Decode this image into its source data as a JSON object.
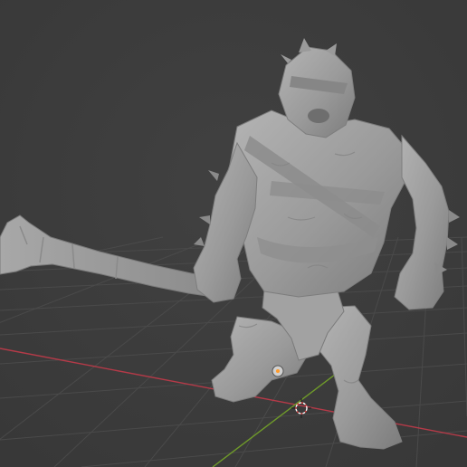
{
  "viewport": {
    "background": "#3d3d3d",
    "grid_color": "#4a4a4a",
    "x_axis_color": "#b43a48",
    "y_axis_color": "#6f9a2a",
    "model_color": "#9e9e9e",
    "model_name": "ogre-sculpt-with-club",
    "gizmos": [
      "3d-cursor-icon",
      "object-origin-icon"
    ]
  }
}
